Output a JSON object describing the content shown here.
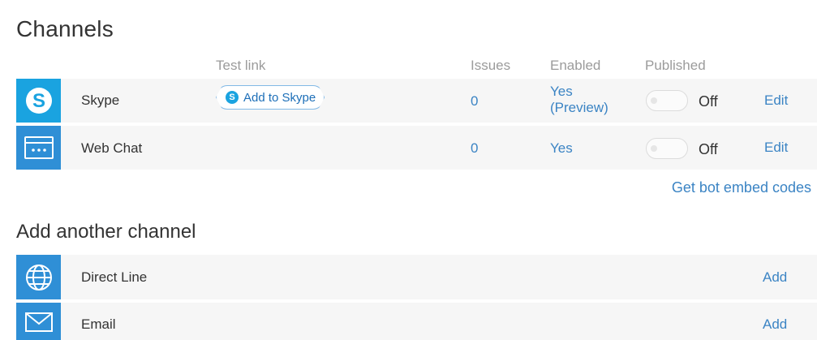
{
  "title": "Channels",
  "columns": {
    "test_link": "Test link",
    "issues": "Issues",
    "enabled": "Enabled",
    "published": "Published"
  },
  "channels": [
    {
      "name": "Skype",
      "icon": "skype-icon",
      "test_link_label": "Add to Skype",
      "issues": "0",
      "enabled_line1": "Yes",
      "enabled_line2": "(Preview)",
      "published": "Off",
      "edit": "Edit"
    },
    {
      "name": "Web Chat",
      "icon": "web-chat-icon",
      "issues": "0",
      "enabled_line1": "Yes",
      "published": "Off",
      "edit": "Edit"
    }
  ],
  "embed_link": "Get bot embed codes",
  "add_title": "Add another channel",
  "available": [
    {
      "name": "Direct Line",
      "icon": "globe-icon",
      "action": "Add"
    },
    {
      "name": "Email",
      "icon": "envelope-icon",
      "action": "Add"
    }
  ],
  "colors": {
    "icon_bg": "#2f8fd6",
    "skype_bg": "#1aa3e0",
    "link": "#3b84c4",
    "header_text": "#9b9b9b",
    "row_bg": "#f6f6f6"
  }
}
